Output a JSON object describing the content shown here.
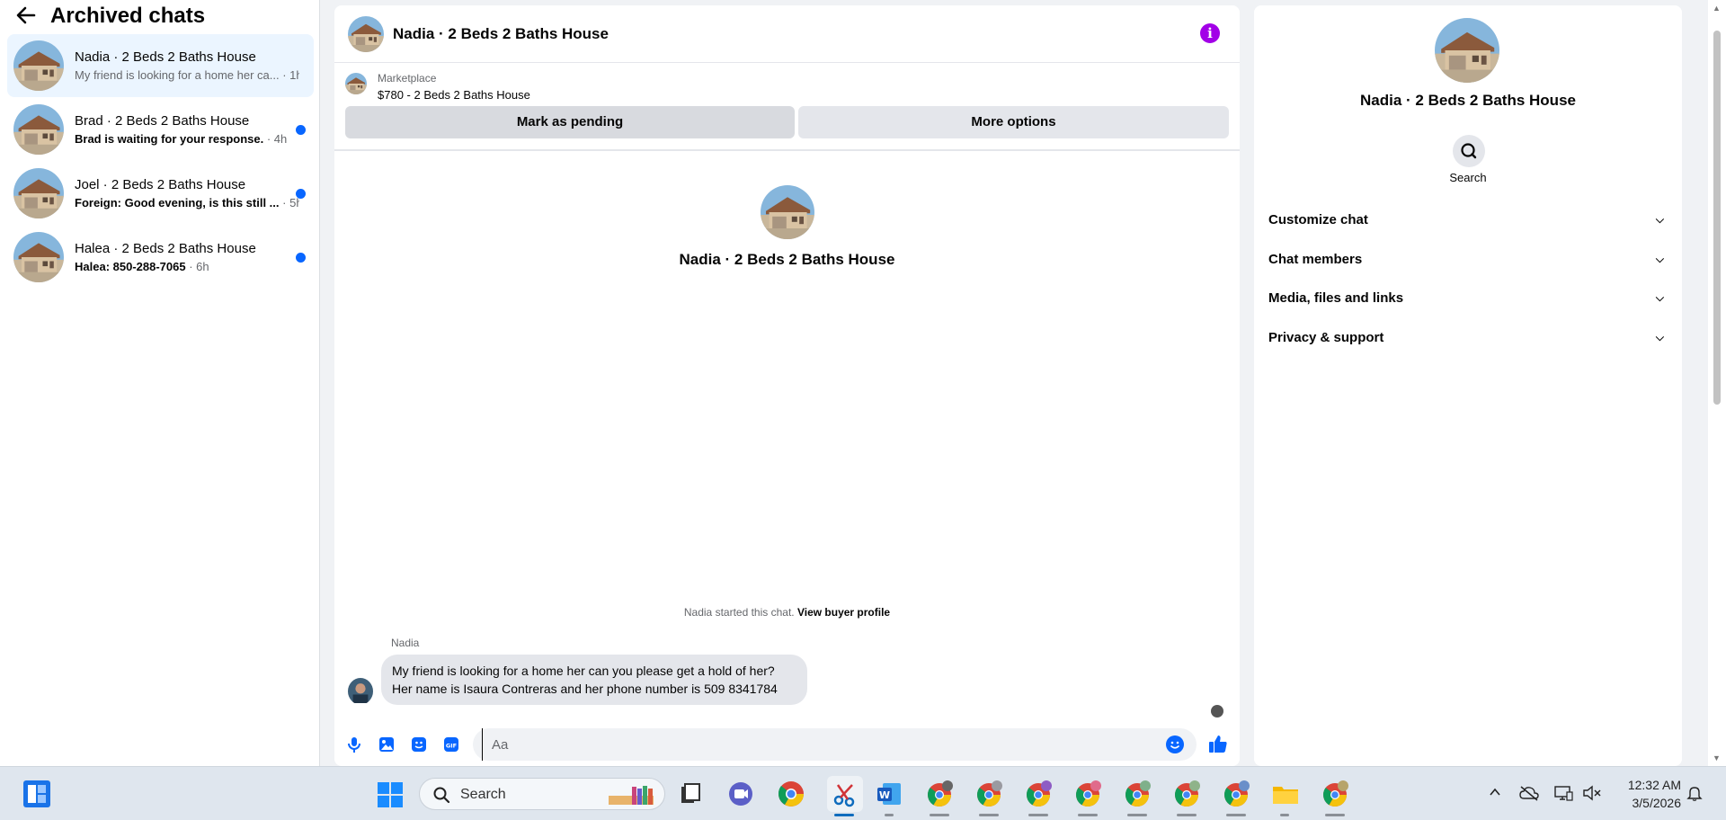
{
  "sidebar": {
    "title": "Archived chats",
    "chats": [
      {
        "name": "Nadia · 2 Beds 2 Baths House",
        "preview": "My friend is looking for a home her ca...",
        "time": "· 1h",
        "unread": false
      },
      {
        "name": "Brad · 2 Beds 2 Baths House",
        "preview": "Brad is waiting for your response.",
        "time": "· 4h",
        "unread": true
      },
      {
        "name": "Joel · 2 Beds 2 Baths House",
        "preview": "Foreign: Good evening, is this still ...",
        "time": "· 5h",
        "unread": true
      },
      {
        "name": "Halea · 2 Beds 2 Baths House",
        "preview": "Halea: 850-288-7065",
        "time": "· 6h",
        "unread": true
      }
    ]
  },
  "main": {
    "title": "Nadia · 2 Beds 2 Baths House",
    "marketplace": {
      "label": "Marketplace",
      "listing": "$780 - 2 Beds 2 Baths House",
      "pending_button": "Mark as pending",
      "more_button": "More options"
    },
    "profile_name": "Nadia · 2 Beds 2 Baths House",
    "started_text": "Nadia started this chat.",
    "buyer_profile_link": "View buyer profile",
    "message": {
      "sender": "Nadia",
      "text": "My friend is looking for a home her can you please get a hold of her? Her name is Isaura Contreras and her phone number is 509 8341784"
    },
    "composer_placeholder": "Aa"
  },
  "right_panel": {
    "name": "Nadia · 2 Beds 2 Baths House",
    "search_label": "Search",
    "sections": [
      "Customize chat",
      "Chat members",
      "Media, files and links",
      "Privacy & support"
    ]
  },
  "taskbar": {
    "search_label": "Search",
    "time": "12:32 AM",
    "date": "3/5/2026"
  },
  "colors": {
    "accent": "#0866ff",
    "info_purple": "#a200e7",
    "active_chat_bg": "#ebf5ff",
    "button_gray": "#e4e6eb"
  }
}
